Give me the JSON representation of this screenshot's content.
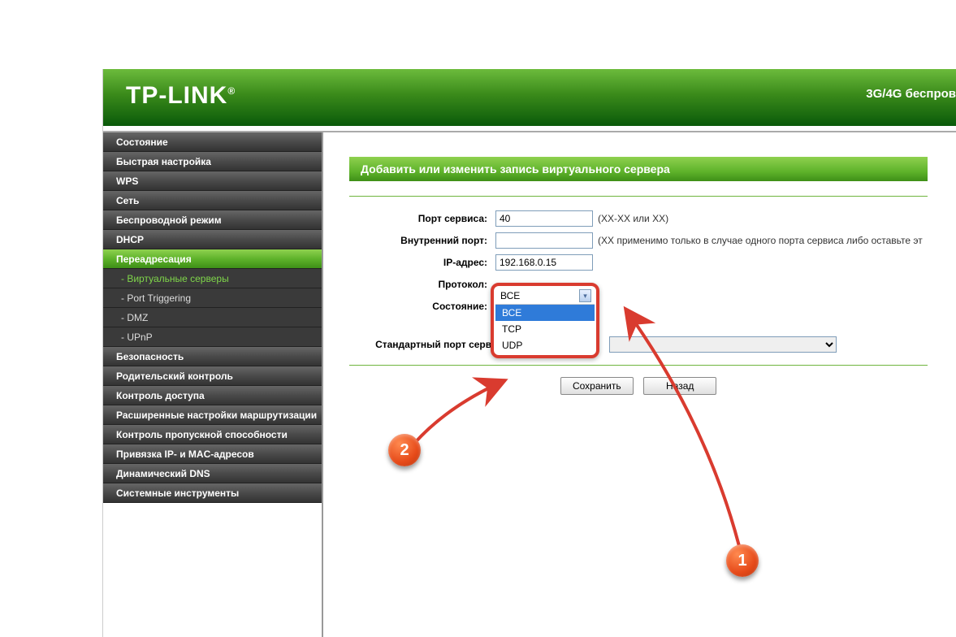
{
  "header": {
    "logo": "TP-LINK",
    "reg": "®",
    "tagline": "3G/4G беспров"
  },
  "menu": [
    "Состояние",
    "Быстрая настройка",
    "WPS",
    "Сеть",
    "Беспроводной режим",
    "DHCP",
    "Переадресация"
  ],
  "submenu": [
    "- Виртуальные серверы",
    "- Port Triggering",
    "- DMZ",
    "- UPnP"
  ],
  "menu_after": [
    "Безопасность",
    "Родительский контроль",
    "Контроль доступа",
    "Расширенные настройки маршрутизации",
    "Контроль пропускной способности",
    "Привязка IP- и MAC-адресов",
    "Динамический DNS",
    "Системные инструменты"
  ],
  "panel": {
    "title": "Добавить или изменить запись виртуального сервера"
  },
  "form": {
    "service_port_label": "Порт сервиса:",
    "service_port_value": "40",
    "service_port_hint": "(XX-XX или XX)",
    "internal_port_label": "Внутренний порт:",
    "internal_port_value": "",
    "internal_port_hint": "(XX применимо только в случае одного порта сервиса либо оставьте эт",
    "ip_label": "IP-адрес:",
    "ip_value": "192.168.0.15",
    "protocol_label": "Протокол:",
    "protocol_selected": "ВСЕ",
    "protocol_options": [
      "ВСЕ",
      "TCP",
      "UDP"
    ],
    "state_label": "Состояние:",
    "std_port_label": "Стандартный порт сервиса:",
    "std_port_value": ""
  },
  "buttons": {
    "save": "Сохранить",
    "back": "Назад"
  },
  "badges": {
    "b1": "1",
    "b2": "2"
  }
}
